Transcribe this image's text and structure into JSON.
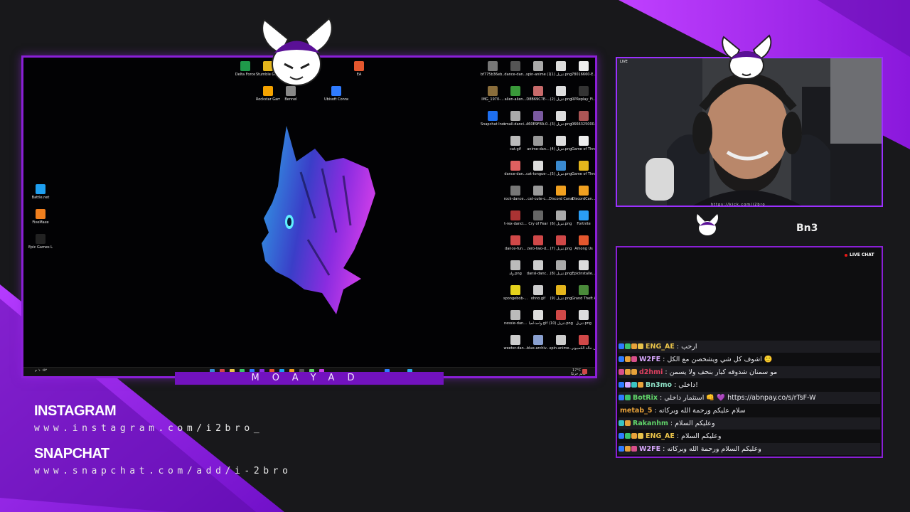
{
  "colors": {
    "accent": "#8a1fd6",
    "accent_light": "#b33cff",
    "background": "#18181b",
    "name_bar": "#7212be"
  },
  "desktop": {
    "left_icons": [
      {
        "label": "Battle.net",
        "color": "#1e9ff0"
      },
      {
        "label": "FiveMaxe",
        "color": "#f07f1e"
      },
      {
        "label": "Epic Games Launcher",
        "color": "#222222"
      }
    ],
    "top_icons": [
      {
        "label": "Delta Force",
        "color": "#1f9a4a"
      },
      {
        "label": "Stumble Guys",
        "color": "#e4b51c"
      },
      {
        "label": "EA",
        "color": "#e4572e"
      },
      {
        "label": "Rockstar Games ...",
        "color": "#f5a300"
      },
      {
        "label": "Bennel",
        "color": "#888888"
      },
      {
        "label": "Ubisoft Connect",
        "color": "#2f7bff"
      }
    ],
    "right_icons": [
      {
        "label": "bf775b36eb...",
        "color": "#777"
      },
      {
        "label": "dance-dan...",
        "color": "#555"
      },
      {
        "label": "spin-anime (1).gif",
        "color": "#aaa"
      },
      {
        "label": "تنزيل (1).png",
        "color": "#ddd"
      },
      {
        "label": "78016660-E...",
        "color": "#eee"
      },
      {
        "label": "IMG_1970-...",
        "color": "#8a6d3b"
      },
      {
        "label": "alien-alien...",
        "color": "#3a9a3a"
      },
      {
        "label": "D8B69C7E-...",
        "color": "#c86b6b"
      },
      {
        "label": "تنزيل (2).png",
        "color": "#ddd"
      },
      {
        "label": "RPReplay_Fi...",
        "color": "#333"
      },
      {
        "label": "Snapchat Installer.exe",
        "color": "#1e6ff0"
      },
      {
        "label": "small-danci...",
        "color": "#aaa"
      },
      {
        "label": "460E9F8A-0...",
        "color": "#7a5aa0"
      },
      {
        "label": "تنزيل (3).png",
        "color": "#ddd"
      },
      {
        "label": "0666325000...",
        "color": "#a55"
      },
      {
        "label": "",
        "color": ""
      },
      {
        "label": "cat.gif",
        "color": "#bbb"
      },
      {
        "label": "anime-dan...",
        "color": "#999"
      },
      {
        "label": "تنزيل (4).png",
        "color": "#ddd"
      },
      {
        "label": "Game of Thrones K...",
        "color": "#eee"
      },
      {
        "label": "",
        "color": ""
      },
      {
        "label": "dance-dan...",
        "color": "#e06060"
      },
      {
        "label": "cat-tongue-...",
        "color": "#ddd"
      },
      {
        "label": "تنزيل (5).png",
        "color": "#3a8ad0"
      },
      {
        "label": "Game of Thrones K...",
        "color": "#e4b51c"
      },
      {
        "label": "",
        "color": ""
      },
      {
        "label": "rock-dance...",
        "color": "#777"
      },
      {
        "label": "cat-cute-c...",
        "color": "#999"
      },
      {
        "label": "Discord Canary",
        "color": "#f0a020"
      },
      {
        "label": "DiscordCan...",
        "color": "#f0a020"
      },
      {
        "label": "",
        "color": ""
      },
      {
        "label": "t-rex-danci...",
        "color": "#a33"
      },
      {
        "label": "Cry of Fear",
        "color": "#666"
      },
      {
        "label": "تنزيل (6).png",
        "color": "#aaa"
      },
      {
        "label": "Fortnite",
        "color": "#2a9df4"
      },
      {
        "label": "",
        "color": ""
      },
      {
        "label": "dance-fun...",
        "color": "#d04848"
      },
      {
        "label": "zero-two-d...",
        "color": "#d04848"
      },
      {
        "label": "تنزيل (7).png",
        "color": "#d04848"
      },
      {
        "label": "Among Us",
        "color": "#e4572e"
      },
      {
        "label": "",
        "color": ""
      },
      {
        "label": "ولد.png",
        "color": "#bbb"
      },
      {
        "label": "dansi-danc...",
        "color": "#ccc"
      },
      {
        "label": "تنزيل (8).png",
        "color": "#aaa"
      },
      {
        "label": "EpicInstalle...",
        "color": "#ddd"
      },
      {
        "label": "",
        "color": ""
      },
      {
        "label": "spongebob-...",
        "color": "#e4d21c"
      },
      {
        "label": "ohno.gif",
        "color": "#ccc"
      },
      {
        "label": "تنزيل (9).png",
        "color": "#e4b51c"
      },
      {
        "label": "Grand Theft Auto V",
        "color": "#4a8a3a"
      },
      {
        "label": "",
        "color": ""
      },
      {
        "label": "nessie-dan...",
        "color": "#bbb"
      },
      {
        "label": "واحد-لعيا.gif",
        "color": "#ddd"
      },
      {
        "label": "تنزيل (10).png",
        "color": "#d04848"
      },
      {
        "label": "تنزيل.png",
        "color": "#ddd"
      },
      {
        "label": "",
        "color": ""
      },
      {
        "label": "weeter-dan...",
        "color": "#ccc"
      },
      {
        "label": "blue-archiv...",
        "color": "#8aa0d0"
      },
      {
        "label": "spin-anime...",
        "color": "#ccc"
      },
      {
        "label": "تشغيل حالة الكمبيوتر",
        "color": "#d04848"
      }
    ],
    "taskbar": {
      "left_text": "١٠:٥٢ م",
      "weather": "17°C",
      "weather_desc": "غائم جزئيًا"
    }
  },
  "name_bar": {
    "text": "MOAYAD"
  },
  "webcam": {
    "live_label": "LIVE",
    "url": "https://kick.com/i2bro",
    "username": "Bn3"
  },
  "chat": {
    "live_label": "LIVE CHAT",
    "messages": [
      {
        "user": "ENG_AE",
        "color": "#e8c24a",
        "text": "ارحب",
        "badges": [
          "#2f7bff",
          "#3ac46a",
          "#e8a23a",
          "#e8c24a"
        ]
      },
      {
        "user": "W2FE",
        "color": "#d9a8ff",
        "text": "اشوف كل شي ويشخصن مع الكل 🙂",
        "badges": [
          "#2f7bff",
          "#e8a23a",
          "#d94f8a"
        ]
      },
      {
        "user": "d2hmi",
        "color": "#e04060",
        "text": "مو سمنان شدوقه كبار بنحف ولا يسمن",
        "badges": [
          "#d94f8a",
          "#e8a23a",
          "#e8a23a"
        ]
      },
      {
        "user": "Bn3mo",
        "color": "#8fe3c8",
        "text": "داخلي!",
        "badges": [
          "#2f7bff",
          "#d9a8ff",
          "#3ac4c4",
          "#e8a23a"
        ]
      },
      {
        "user": "BotRix",
        "color": "#61d66a",
        "text": "استثمار داخلي 👊 💜 https://abnpay.co/s/rTsF-W",
        "badges": [
          "#2f7bff",
          "#3ac46a"
        ]
      },
      {
        "user": "metab_5",
        "color": "#e8a23a",
        "text": "سلام عليكم ورحمة الله وبركاته",
        "badges": []
      },
      {
        "user": "Rakanhm",
        "color": "#61d66a",
        "text": "وعليكم السلام",
        "badges": [
          "#3ac4c4",
          "#e8a23a"
        ]
      },
      {
        "user": "ENG_AE",
        "color": "#e8c24a",
        "text": "وعليكم السلام",
        "badges": [
          "#2f7bff",
          "#3ac46a",
          "#e8a23a",
          "#e8c24a"
        ]
      },
      {
        "user": "W2FE",
        "color": "#d9a8ff",
        "text": "وعليكم السلام ورحمة الله وبركاته",
        "badges": [
          "#2f7bff",
          "#e8a23a",
          "#d94f8a"
        ]
      }
    ]
  },
  "social": {
    "instagram_title": "INSTAGRAM",
    "instagram_url": "www.instagram.com/i2bro_",
    "snapchat_title": "SNAPCHAT",
    "snapchat_url": "www.snapchat.com/add/i-2bro"
  }
}
